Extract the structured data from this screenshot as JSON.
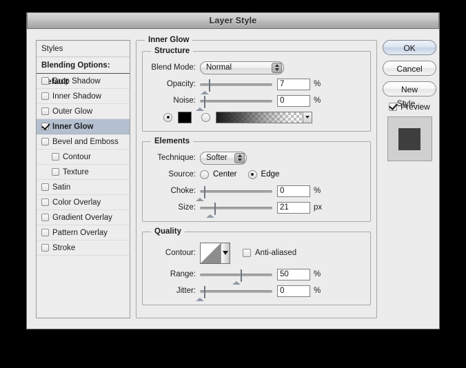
{
  "window": {
    "title": "Layer Style"
  },
  "styles_panel": {
    "header": "Styles",
    "blending_options": "Blending Options: Default",
    "items": [
      {
        "label": "Drop Shadow",
        "checked": false,
        "indent": false,
        "selected": false
      },
      {
        "label": "Inner Shadow",
        "checked": false,
        "indent": false,
        "selected": false
      },
      {
        "label": "Outer Glow",
        "checked": false,
        "indent": false,
        "selected": false
      },
      {
        "label": "Inner Glow",
        "checked": true,
        "indent": false,
        "selected": true
      },
      {
        "label": "Bevel and Emboss",
        "checked": false,
        "indent": false,
        "selected": false
      },
      {
        "label": "Contour",
        "checked": false,
        "indent": true,
        "selected": false
      },
      {
        "label": "Texture",
        "checked": false,
        "indent": true,
        "selected": false
      },
      {
        "label": "Satin",
        "checked": false,
        "indent": false,
        "selected": false
      },
      {
        "label": "Color Overlay",
        "checked": false,
        "indent": false,
        "selected": false
      },
      {
        "label": "Gradient Overlay",
        "checked": false,
        "indent": false,
        "selected": false
      },
      {
        "label": "Pattern Overlay",
        "checked": false,
        "indent": false,
        "selected": false
      },
      {
        "label": "Stroke",
        "checked": false,
        "indent": false,
        "selected": false
      }
    ]
  },
  "panel": {
    "title": "Inner Glow",
    "structure": {
      "title": "Structure",
      "blend_mode_label": "Blend Mode:",
      "blend_mode_value": "Normal",
      "opacity_label": "Opacity:",
      "opacity_value": "7",
      "opacity_unit": "%",
      "opacity_percent": 7,
      "noise_label": "Noise:",
      "noise_value": "0",
      "noise_unit": "%",
      "noise_percent": 0,
      "fill_type": "color",
      "color_hex": "#000000"
    },
    "elements": {
      "title": "Elements",
      "technique_label": "Technique:",
      "technique_value": "Softer",
      "source_label": "Source:",
      "source_center_label": "Center",
      "source_edge_label": "Edge",
      "source_selected": "Edge",
      "choke_label": "Choke:",
      "choke_value": "0",
      "choke_unit": "%",
      "choke_percent": 0,
      "size_label": "Size:",
      "size_value": "21",
      "size_unit": "px",
      "size_percent": 14
    },
    "quality": {
      "title": "Quality",
      "contour_label": "Contour:",
      "anti_aliased_label": "Anti-aliased",
      "anti_aliased_checked": false,
      "range_label": "Range:",
      "range_value": "50",
      "range_unit": "%",
      "range_percent": 50,
      "jitter_label": "Jitter:",
      "jitter_value": "0",
      "jitter_unit": "%",
      "jitter_percent": 0
    }
  },
  "actions": {
    "ok": "OK",
    "cancel": "Cancel",
    "new_style": "New Style...",
    "preview_label": "Preview",
    "preview_checked": true
  },
  "colors": {
    "selection": "#b4bfd0",
    "dialog_bg": "#ececec",
    "preview_bg": "#d0d0d0",
    "preview_fg": "#3e3e3e"
  }
}
